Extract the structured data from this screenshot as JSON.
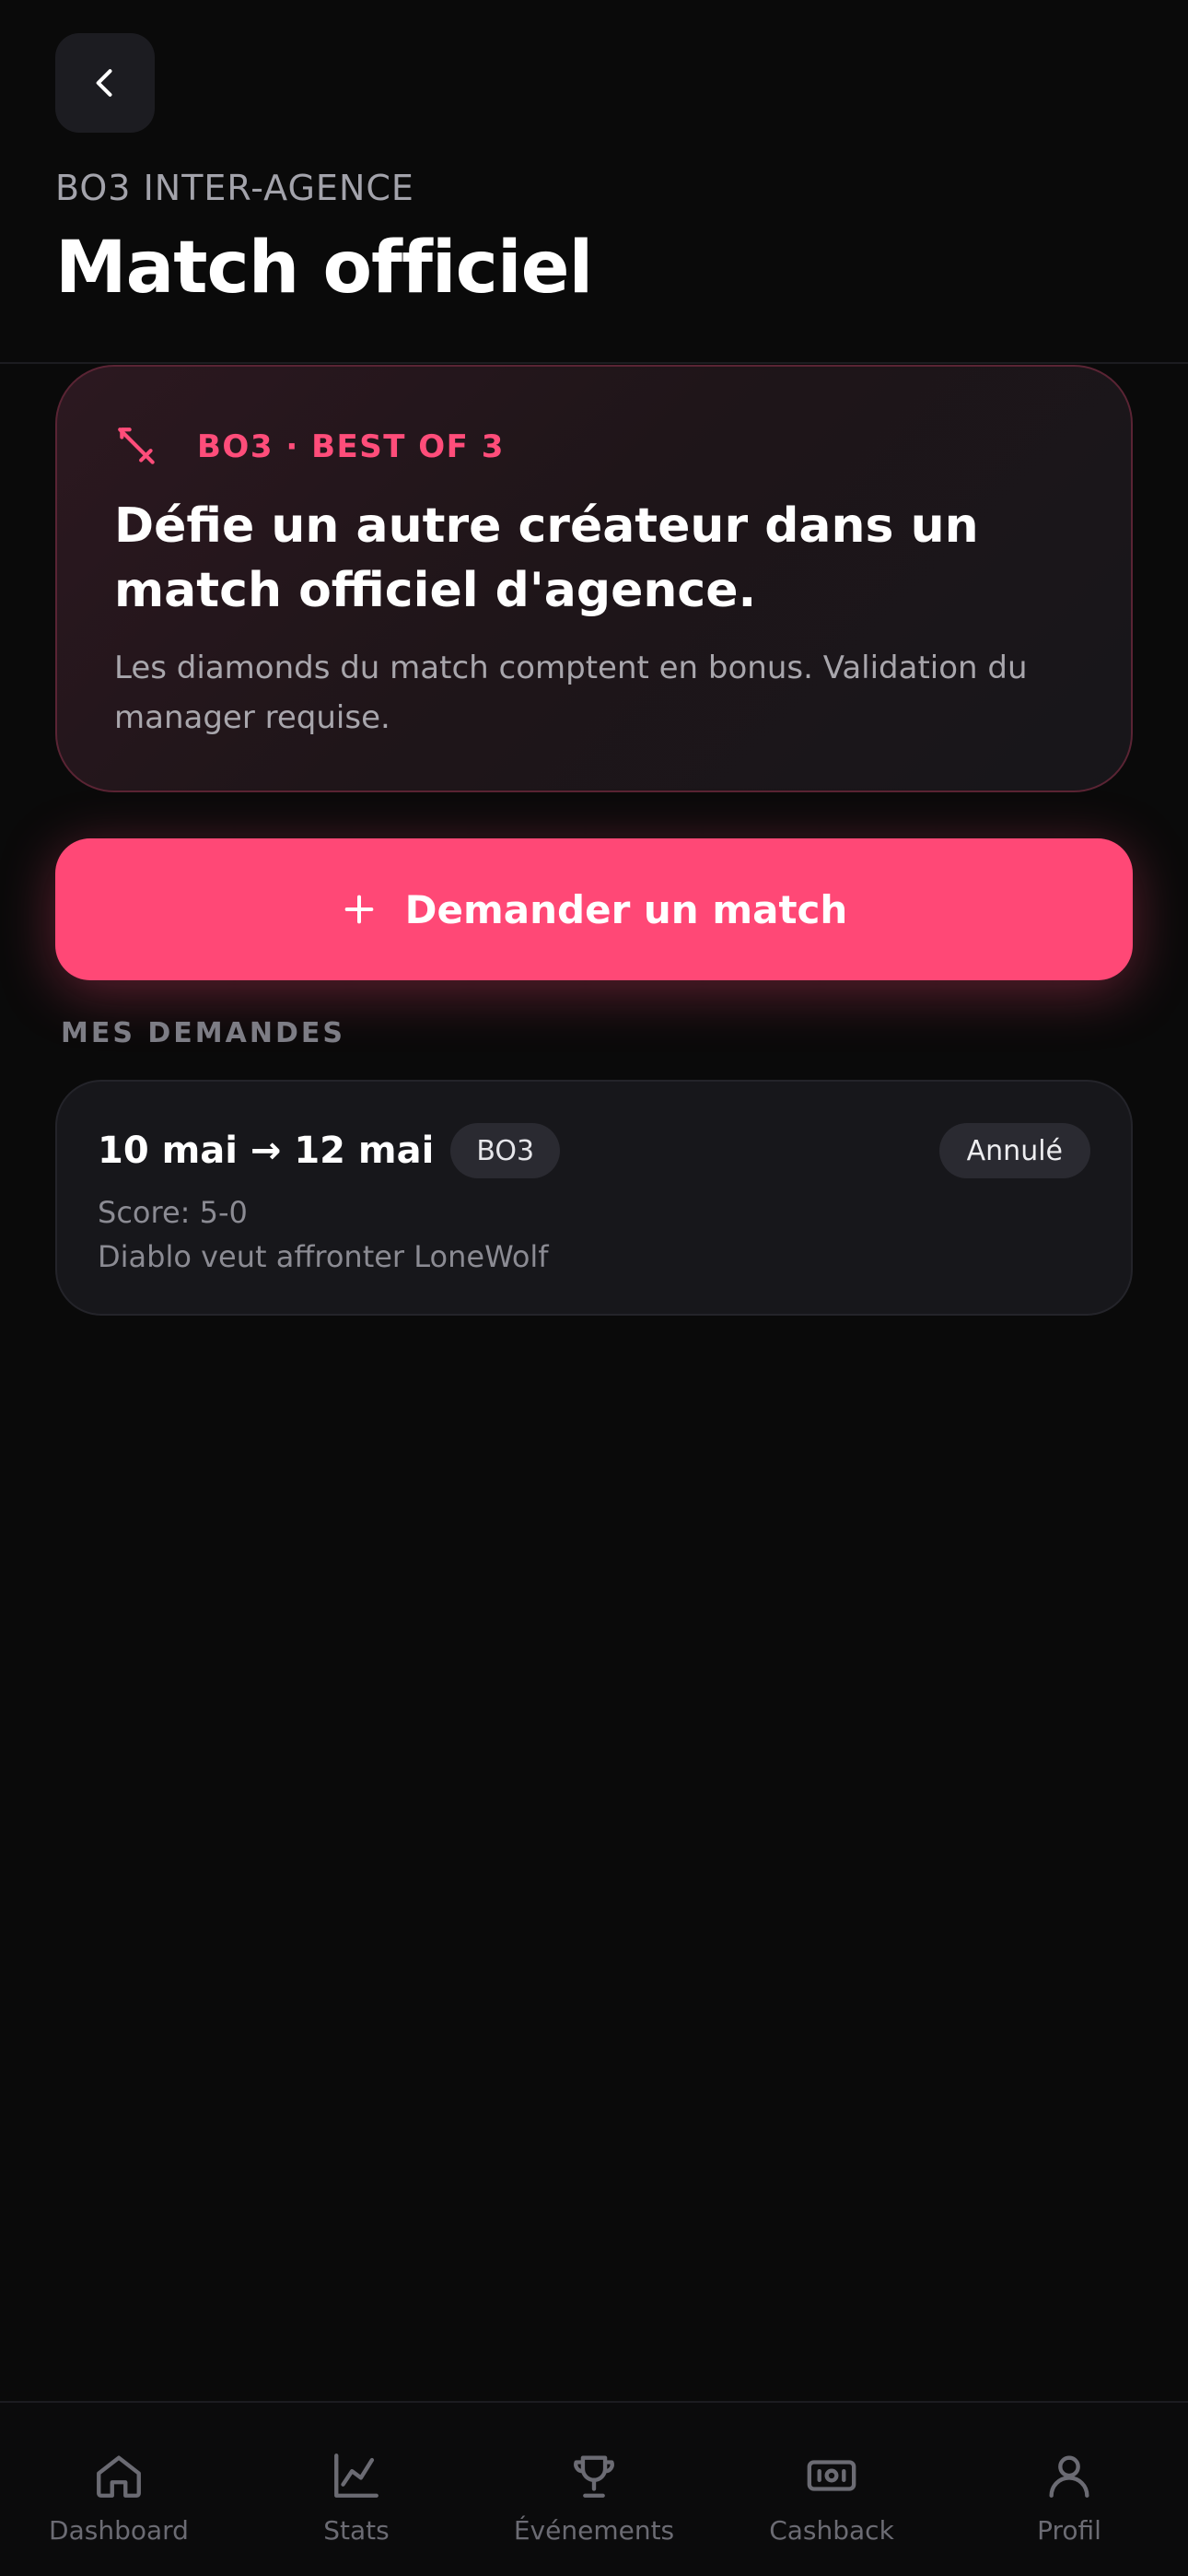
{
  "header": {
    "eyebrow": "BO3 INTER-AGENCE",
    "title": "Match officiel"
  },
  "hero": {
    "tag": "BO3 · BEST OF 3",
    "heading": "Défie un autre créateur dans un match officiel d'agence.",
    "description": "Les diamonds du match comptent en bonus. Validation du manager requise."
  },
  "cta": {
    "label": "Demander un match"
  },
  "requests": {
    "section_label": "MES DEMANDES",
    "items": [
      {
        "dates": "10 mai → 12 mai",
        "format": "BO3",
        "status": "Annulé",
        "score": "Score: 5-0",
        "summary": "Diablo veut affronter LoneWolf"
      }
    ]
  },
  "nav": {
    "items": [
      {
        "label": "Dashboard",
        "icon": "home-icon"
      },
      {
        "label": "Stats",
        "icon": "chart-icon"
      },
      {
        "label": "Événements",
        "icon": "trophy-icon"
      },
      {
        "label": "Cashback",
        "icon": "cash-icon"
      },
      {
        "label": "Profil",
        "icon": "user-icon"
      }
    ]
  },
  "colors": {
    "accent": "#ff4876",
    "background": "#0a0a0a",
    "card": "#17171b"
  }
}
